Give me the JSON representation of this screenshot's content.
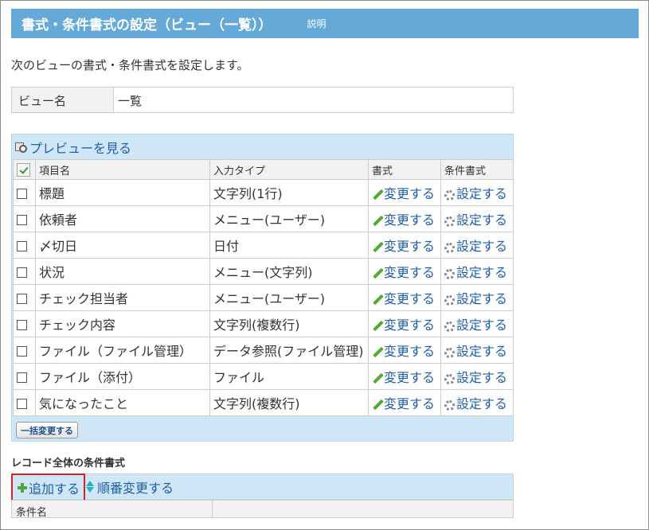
{
  "header": {
    "title": "書式・条件書式の設定（ビュー（一覧））",
    "help_link": "説明"
  },
  "intro_text": "次のビューの書式・条件書式を設定します。",
  "view": {
    "label": "ビュー名",
    "value": "一覧"
  },
  "preview_link": "プレビューを見る",
  "table": {
    "columns": [
      "項目名",
      "入力タイプ",
      "書式",
      "条件書式"
    ],
    "change_label": "変更する",
    "set_label": "設定する",
    "rows": [
      {
        "name": "標題",
        "type": "文字列(1行)"
      },
      {
        "name": "依頼者",
        "type": "メニュー(ユーザー)"
      },
      {
        "name": "〆切日",
        "type": "日付"
      },
      {
        "name": "状況",
        "type": "メニュー(文字列)"
      },
      {
        "name": "チェック担当者",
        "type": "メニュー(ユーザー)"
      },
      {
        "name": "チェック内容",
        "type": "文字列(複数行)"
      },
      {
        "name": "ファイル（ファイル管理）",
        "type": "データ参照(ファイル管理)"
      },
      {
        "name": "ファイル（添付）",
        "type": "ファイル"
      },
      {
        "name": "気になったこと",
        "type": "文字列(複数行)"
      }
    ]
  },
  "bulk_change_button": "一括変更する",
  "record_section": {
    "title": "レコード全体の条件書式",
    "add_label": "追加する",
    "reorder_label": "順番変更する",
    "column_label": "条件名"
  },
  "colors": {
    "titlebar": "#64a9d8",
    "link": "#1f5fa8",
    "panel": "#cfe6f6",
    "highlight": "#e02020"
  }
}
